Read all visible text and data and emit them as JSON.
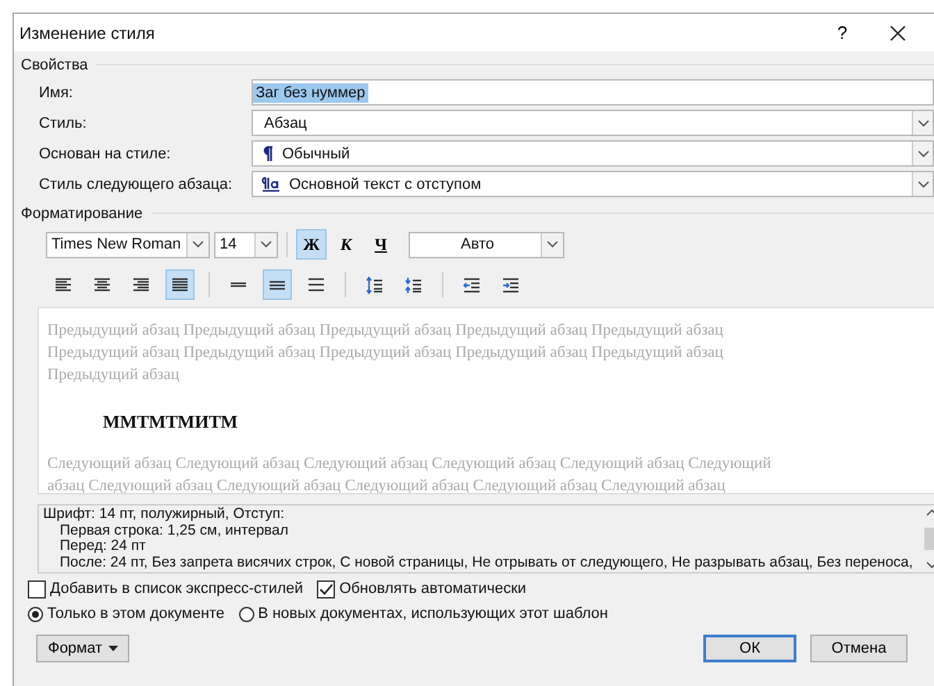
{
  "window": {
    "title": "Изменение стиля",
    "help": "?"
  },
  "properties": {
    "title": "Свойства",
    "fields": [
      {
        "label": "Имя:",
        "value": "Заг без нуммер",
        "kind": "text",
        "selected": true
      },
      {
        "label": "Стиль:",
        "value": "Абзац",
        "kind": "dropdown"
      },
      {
        "label": "Основан на стиле:",
        "value": "Обычный",
        "kind": "paragraph-style"
      },
      {
        "label": "Стиль следующего абзаца:",
        "value": "Основной текст с отступом",
        "kind": "linked-style"
      }
    ]
  },
  "formatting": {
    "title": "Форматирование",
    "font": "Times New Roman",
    "size": "14",
    "style_buttons": [
      {
        "label": "Ж",
        "kind": "bold",
        "selected": true
      },
      {
        "label": "К",
        "kind": "italic",
        "selected": false
      },
      {
        "label": "Ч",
        "kind": "underline",
        "selected": false
      }
    ],
    "font_color_label": "Авто",
    "paragraph_buttons": [
      [
        {
          "kind": "align-left",
          "selected": false
        },
        {
          "kind": "align-center",
          "selected": false
        },
        {
          "kind": "align-right",
          "selected": false
        },
        {
          "kind": "justify",
          "selected": true
        }
      ],
      [
        {
          "kind": "single",
          "selected": false
        },
        {
          "kind": "one-half",
          "selected": true
        },
        {
          "kind": "double",
          "selected": false
        }
      ],
      [
        {
          "kind": "space-more",
          "selected": false
        },
        {
          "kind": "space-less",
          "selected": false
        }
      ],
      [
        {
          "kind": "outdent",
          "selected": false
        },
        {
          "kind": "indent",
          "selected": false
        }
      ]
    ]
  },
  "preview": {
    "previous_lines": [
      "Предыдущий абзац Предыдущий абзац Предыдущий абзац Предыдущий абзац Предыдущий абзац",
      "Предыдущий абзац Предыдущий абзац Предыдущий абзац Предыдущий абзац Предыдущий абзац",
      "Предыдущий абзац"
    ],
    "sample": "ММТМТМИТМ",
    "next_lines": [
      "Следующий абзац Следующий абзац Следующий абзац Следующий абзац Следующий абзац Следующий",
      "абзац Следующий абзац Следующий абзац Следующий абзац Следующий абзац Следующий абзац"
    ]
  },
  "description": {
    "heading": "Шрифт: 14 пт, полужирный, Отступ:",
    "details": [
      "Первая строка:  1,25 см, интервал",
      "Перед:  24 пт",
      "После:  24 пт, Без запрета висячих строк, С новой страницы, Не отрывать от следующего, Не разрывать абзац, Без переноса,"
    ]
  },
  "checkboxes": [
    {
      "label": "Добавить в список экспресс-стилей",
      "checked": false
    },
    {
      "label": "Обновлять автоматически",
      "checked": true
    }
  ],
  "radios": [
    {
      "label": "Только в этом документе",
      "selected": true
    },
    {
      "label": "В новых документах, использующих этот шаблон",
      "selected": false
    }
  ],
  "buttons": {
    "format": "Формат",
    "ok": "ОК",
    "cancel": "Отмена"
  }
}
